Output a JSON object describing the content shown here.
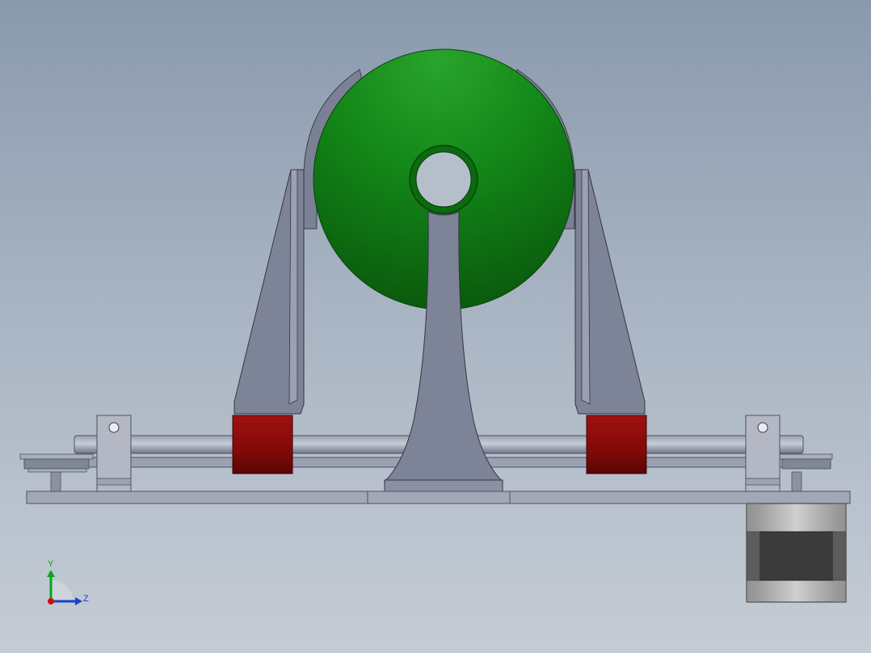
{
  "viewport": {
    "background_top": "#8a99ad",
    "background_bottom": "#c5ccd5"
  },
  "model": {
    "sphere_color": "#0f7e12",
    "frame_color": "#7c8397",
    "roller_color": "#8a0c0c",
    "motor_color": "#3d3d3d"
  },
  "triad": {
    "y_label": "Y",
    "z_label": "Z",
    "y_color": "#0aa51e",
    "z_color": "#1b3fd0",
    "x_color": "#d01010"
  }
}
